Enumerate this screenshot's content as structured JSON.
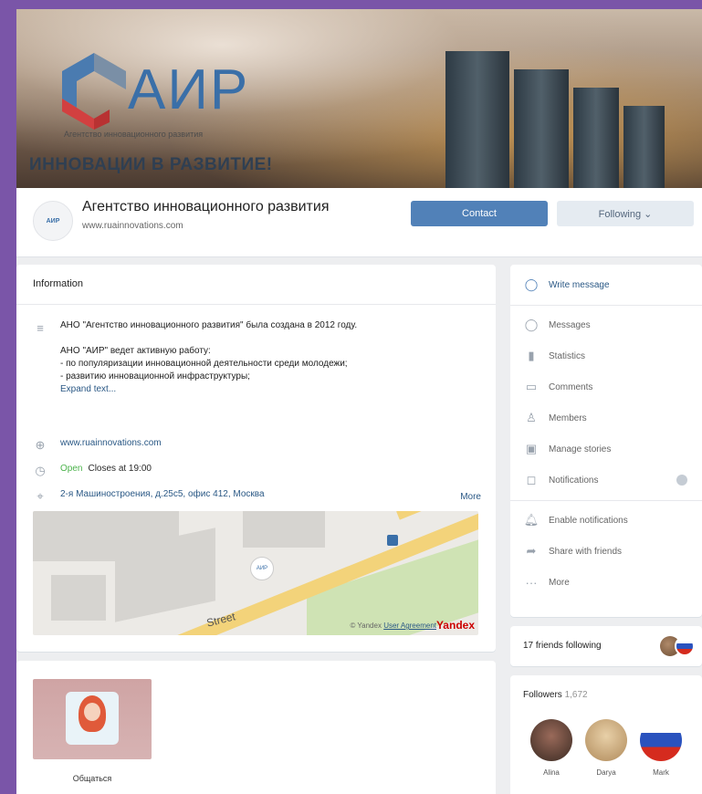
{
  "cover": {
    "logo_text": "АИР",
    "logo_sub": "Агентство инновационного развития",
    "slogan": "ИННОВАЦИИ В РАЗВИТИЕ!"
  },
  "header": {
    "avatar_text": "АИР",
    "title": "Агентство инновационного развития",
    "website": "www.ruainnovations.com",
    "contact_label": "Contact",
    "following_label": "Following ⌄"
  },
  "info": {
    "heading": "Information",
    "description": [
      "АНО \"Агентство инновационного развития\" была создана в 2012 году.",
      "",
      "АНО \"АИР\" ведет активную работу:",
      "- по популяризации инновационной деятельности среди молодежи;",
      "- развитию инновационной инфраструктуры;"
    ],
    "expand_label": "Expand text...",
    "website": "www.ruainnovations.com",
    "status_open": "Open",
    "status_closes": "Closes at 19:00",
    "address": "2-я Машиностроения, д.25с5, офис 412, Москва",
    "more_label": "More",
    "map": {
      "street": "Street",
      "copyright": "© Yandex",
      "agreement": "User Agreement",
      "brand": "Yandex",
      "pin_text": "АИР"
    }
  },
  "menu": {
    "write_message": "Write message",
    "messages": "Messages",
    "statistics": "Statistics",
    "comments": "Comments",
    "members": "Members",
    "manage_stories": "Manage stories",
    "notifications": "Notifications",
    "enable_notifications": "Enable notifications",
    "share": "Share with friends",
    "more": "More"
  },
  "friends": {
    "label": "17 friends following"
  },
  "followers": {
    "label": "Followers",
    "count": "1,672",
    "people": [
      {
        "name": "Alina"
      },
      {
        "name": "Darya"
      },
      {
        "name": "Mark"
      }
    ]
  },
  "albums": {
    "caption": "Общаться"
  },
  "colors": {
    "accent": "#5181b8",
    "link": "#2a5885",
    "open": "#4bb34b",
    "frame": "#7a55a8"
  }
}
